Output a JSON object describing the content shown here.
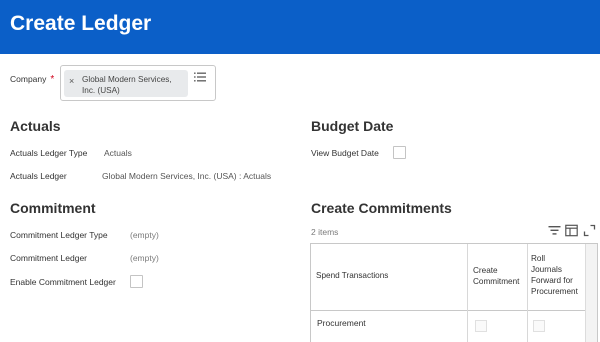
{
  "header": {
    "title": "Create Ledger"
  },
  "company": {
    "label": "Company",
    "required_mark": "*",
    "chip_remove": "×",
    "chip_text": "Global Modern Services, Inc. (USA)",
    "list_icon": "list-icon"
  },
  "actuals": {
    "title": "Actuals",
    "ledger_type_label": "Actuals Ledger Type",
    "ledger_type_value": "Actuals",
    "ledger_label": "Actuals Ledger",
    "ledger_value": "Global Modern Services, Inc. (USA) : Actuals"
  },
  "budget_date": {
    "title": "Budget Date",
    "view_label": "View Budget Date",
    "view_checked": false
  },
  "commitment": {
    "title": "Commitment",
    "ledger_type_label": "Commitment Ledger Type",
    "ledger_type_value": "(empty)",
    "ledger_label": "Commitment Ledger",
    "ledger_value": "(empty)",
    "enable_label": "Enable Commitment Ledger",
    "enable_checked": false
  },
  "create_commitments": {
    "title": "Create Commitments",
    "count": "2 items",
    "toolbar_icons": [
      "filter-icon",
      "columns-icon",
      "expand-icon"
    ],
    "columns": [
      "Spend Transactions",
      "Create Commitment",
      "Roll Journals Forward for Procurement"
    ],
    "col_create_line1": "Create",
    "col_create_line2": "Commitment",
    "col_roll_line1": "Roll",
    "col_roll_line2": "Journals",
    "col_roll_line3": "Forward for",
    "col_roll_line4": "Procurement",
    "rows": [
      {
        "spend_transaction": "Procurement",
        "create_commitment": false,
        "roll_forward": false
      }
    ]
  },
  "colors": {
    "header_bg": "#0b5fc8",
    "required": "#d0021b",
    "chip_bg": "#e8eaec"
  }
}
